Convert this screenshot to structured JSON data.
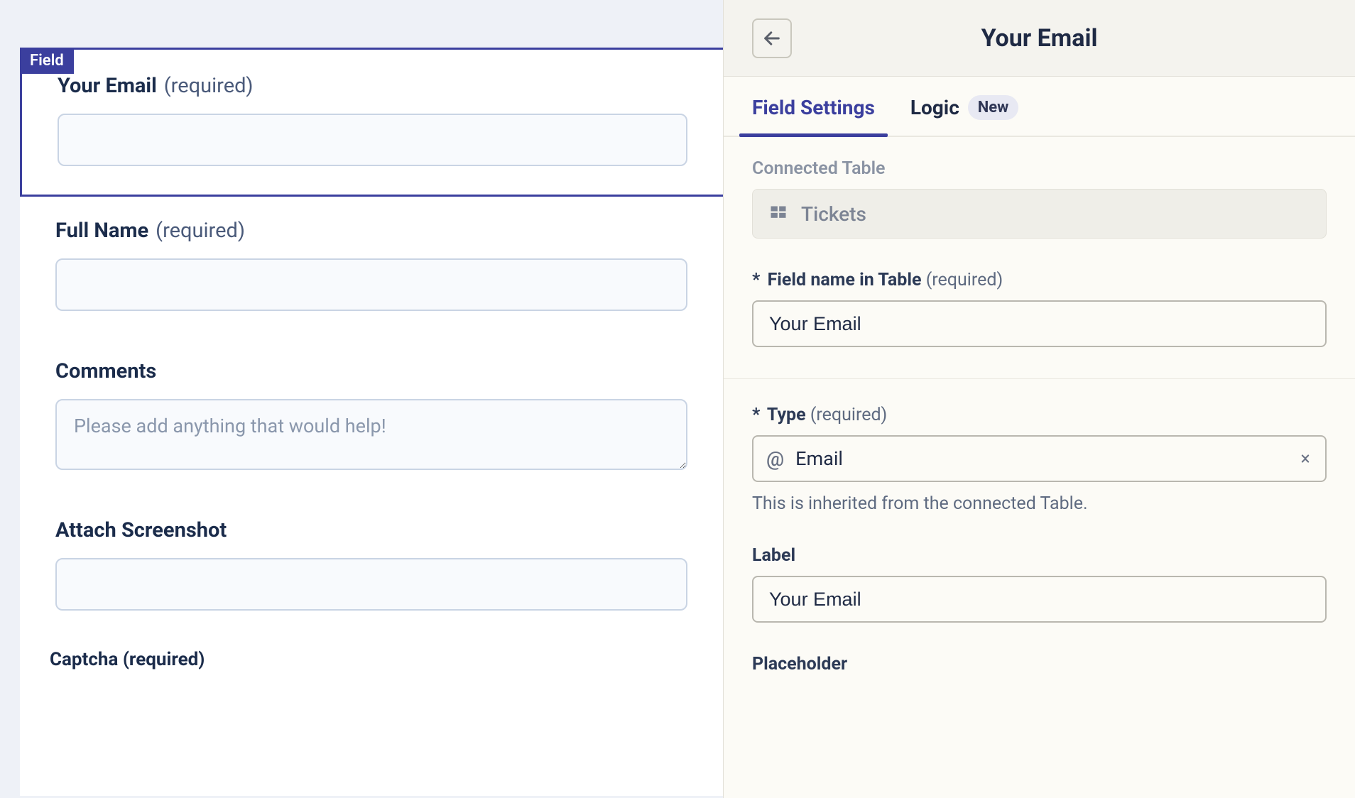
{
  "form": {
    "field_tag": "Field",
    "fields": [
      {
        "label": "Your Email",
        "required_text": "(required)",
        "placeholder": "",
        "value": ""
      },
      {
        "label": "Full Name",
        "required_text": "(required)",
        "placeholder": "",
        "value": ""
      },
      {
        "label": "Comments",
        "required_text": "",
        "placeholder": "Please add anything that would help!",
        "value": ""
      },
      {
        "label": "Attach Screenshot",
        "required_text": "",
        "placeholder": "",
        "value": ""
      }
    ],
    "captcha_label": "Captcha (required)"
  },
  "panel": {
    "title": "Your Email",
    "tabs": {
      "field_settings": "Field Settings",
      "logic": "Logic",
      "logic_badge": "New"
    },
    "connected_table": {
      "label": "Connected Table",
      "value": "Tickets"
    },
    "field_name": {
      "req_mark": "*",
      "label": "Field name in Table",
      "req_text": "(required)",
      "value": "Your Email"
    },
    "type": {
      "req_mark": "*",
      "label": "Type",
      "req_text": "(required)",
      "value": "Email",
      "helper": "This is inherited from the connected Table."
    },
    "label_setting": {
      "label": "Label",
      "value": "Your Email"
    },
    "placeholder_setting": {
      "label": "Placeholder"
    }
  }
}
